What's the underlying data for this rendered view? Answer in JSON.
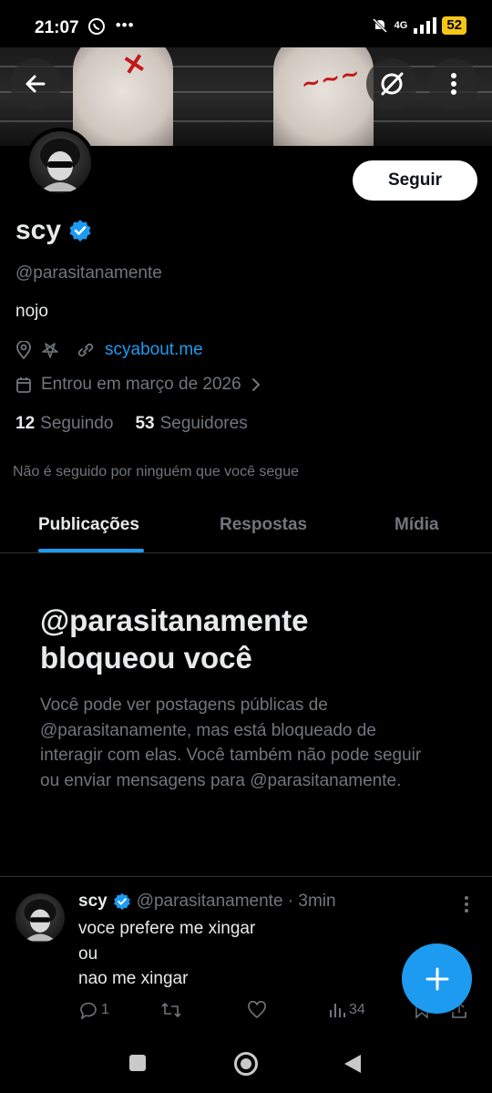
{
  "status": {
    "time": "21:07",
    "network": "4G",
    "battery": "52"
  },
  "profile": {
    "follow_label": "Seguir",
    "name": "scy",
    "handle": "@parasitanamente",
    "bio": "nojo",
    "link": "scyabout.me",
    "joined": "Entrou em março de 2026",
    "following_count": "12",
    "following_label": "Seguindo",
    "followers_count": "53",
    "followers_label": "Seguidores",
    "not_followed": "Não é seguido por ninguém que você segue"
  },
  "tabs": [
    {
      "label": "Publicações",
      "active": true
    },
    {
      "label": "Respostas",
      "active": false
    },
    {
      "label": "Mídia",
      "active": false
    }
  ],
  "blocked": {
    "title_line1": "@parasitanamente",
    "title_line2": "bloqueou você",
    "text": "Você pode ver postagens públicas de @parasitanamente, mas está bloqueado de interagir com elas. Você também não pode seguir ou enviar mensagens para @parasitanamente."
  },
  "post": {
    "name": "scy",
    "meta": "@parasitanamente · 3min",
    "lines": [
      "voce prefere me xingar",
      "ou",
      "nao me xingar"
    ],
    "reply_count": "1",
    "views_count": "34"
  },
  "colors": {
    "accent": "#1d9bf0",
    "muted": "#71767b",
    "text": "#e7e9ea",
    "border": "#2f3336"
  }
}
